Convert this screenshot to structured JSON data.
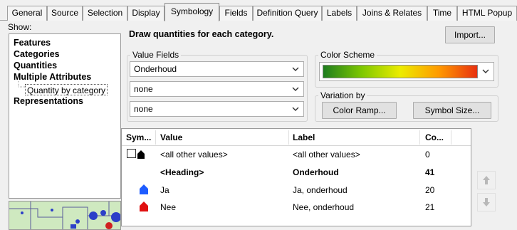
{
  "tabs": [
    {
      "label": "General"
    },
    {
      "label": "Source"
    },
    {
      "label": "Selection"
    },
    {
      "label": "Display"
    },
    {
      "label": "Symbology",
      "active": true
    },
    {
      "label": "Fields"
    },
    {
      "label": "Definition Query"
    },
    {
      "label": "Labels"
    },
    {
      "label": "Joins & Relates"
    },
    {
      "label": "Time"
    },
    {
      "label": "HTML Popup"
    }
  ],
  "show_label": "Show:",
  "show_items": [
    {
      "label": "Features",
      "bold": true
    },
    {
      "label": "Categories",
      "bold": true
    },
    {
      "label": "Quantities",
      "bold": true
    },
    {
      "label": "Multiple Attributes",
      "bold": true
    },
    {
      "label": "Quantity by category",
      "bold": false,
      "selected": true
    },
    {
      "label": "Representations",
      "bold": true
    }
  ],
  "heading": "Draw quantities for each category.",
  "import_label": "Import...",
  "value_fields": {
    "title": "Value Fields",
    "fields": [
      "Onderhoud",
      "none",
      "none"
    ]
  },
  "color_scheme": {
    "title": "Color Scheme",
    "gradient": [
      "#1e7d1e",
      "#7ec800",
      "#ecec00",
      "#ff9a00",
      "#e8300f"
    ]
  },
  "variation_by": {
    "title": "Variation by",
    "color_ramp_label": "Color Ramp...",
    "symbol_size_label": "Symbol Size..."
  },
  "table": {
    "headers": [
      "Sym...",
      "Value",
      "Label",
      "Co..."
    ],
    "rows": [
      {
        "symbol": "checkbox-and-black-house-icon",
        "value": "<all other values>",
        "label": "<all other values>",
        "count": "0",
        "bold": false
      },
      {
        "symbol": "",
        "value": "<Heading>",
        "label": "Onderhoud",
        "count": "41",
        "bold": true
      },
      {
        "symbol": "blue-house-icon",
        "value": "Ja",
        "label": "Ja, onderhoud",
        "count": "20",
        "bold": false,
        "color": "#1e5cff"
      },
      {
        "symbol": "red-house-icon",
        "value": "Nee",
        "label": "Nee, onderhoud",
        "count": "21",
        "bold": false,
        "color": "#e01010"
      }
    ]
  }
}
